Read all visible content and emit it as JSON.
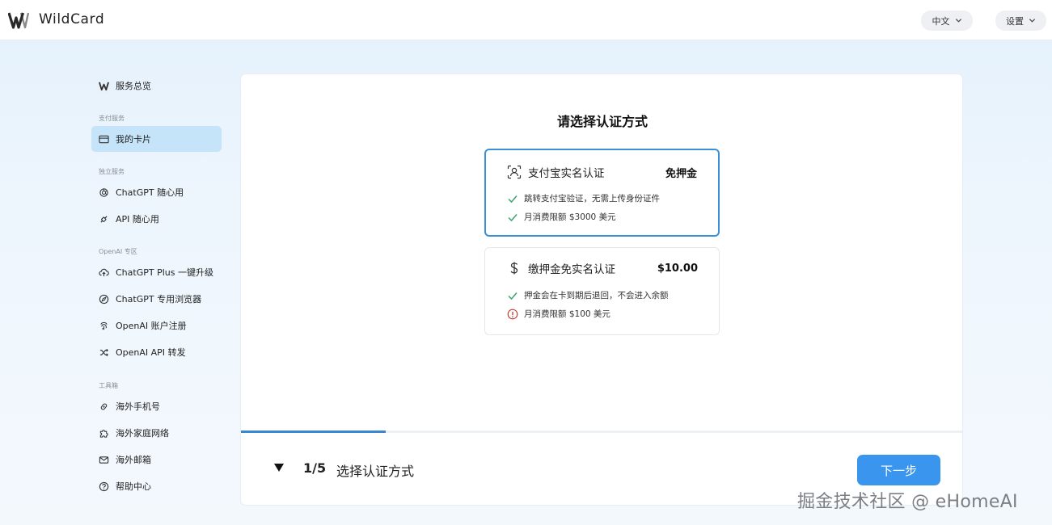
{
  "app": {
    "brand": "WildCard"
  },
  "topbar": {
    "language": "中文",
    "settings": "设置"
  },
  "sidebar": {
    "overview": "服务总览",
    "sections": {
      "payment": "支付服务",
      "independent": "独立服务",
      "openai": "OpenAI 专区",
      "tools": "工具箱"
    },
    "items": {
      "my_cards": "我的卡片",
      "chatgpt_anytime": "ChatGPT 随心用",
      "api_anytime": "API 随心用",
      "chatgpt_plus_upgrade": "ChatGPT Plus 一键升级",
      "chatgpt_browser": "ChatGPT 专用浏览器",
      "openai_register": "OpenAI 账户注册",
      "openai_api_forward": "OpenAI API 转发",
      "overseas_phone": "海外手机号",
      "overseas_home_network": "海外家庭网络",
      "overseas_email": "海外邮箱",
      "help_center": "帮助中心"
    }
  },
  "main": {
    "title": "请选择认证方式",
    "options": [
      {
        "title": "支付宝实名认证",
        "price": "免押金",
        "icon": "person-scan-icon",
        "selected": true,
        "features": [
          {
            "icon": "check-icon",
            "text": "跳转支付宝验证，无需上传身份证件"
          },
          {
            "icon": "check-icon",
            "text": "月消费限额 $3000 美元"
          }
        ]
      },
      {
        "title": "缴押金免实名认证",
        "price": "$10.00",
        "icon": "dollar-icon",
        "selected": false,
        "features": [
          {
            "icon": "check-icon",
            "text": "押金会在卡到期后退回，不会进入余额"
          },
          {
            "icon": "info-icon",
            "text": "月消费限额 $100 美元"
          }
        ]
      }
    ],
    "progress": {
      "fraction": 0.2
    },
    "step": {
      "count": "1/5",
      "label": "选择认证方式"
    },
    "next_button": "下一步"
  },
  "watermark": "掘金技术社区 @ eHomeAI",
  "colors": {
    "accent": "#3a95ee",
    "selected_border": "#3a8fd6",
    "active_nav": "#c5e4fa",
    "check": "#3aa36b",
    "info": "#c0392b"
  }
}
